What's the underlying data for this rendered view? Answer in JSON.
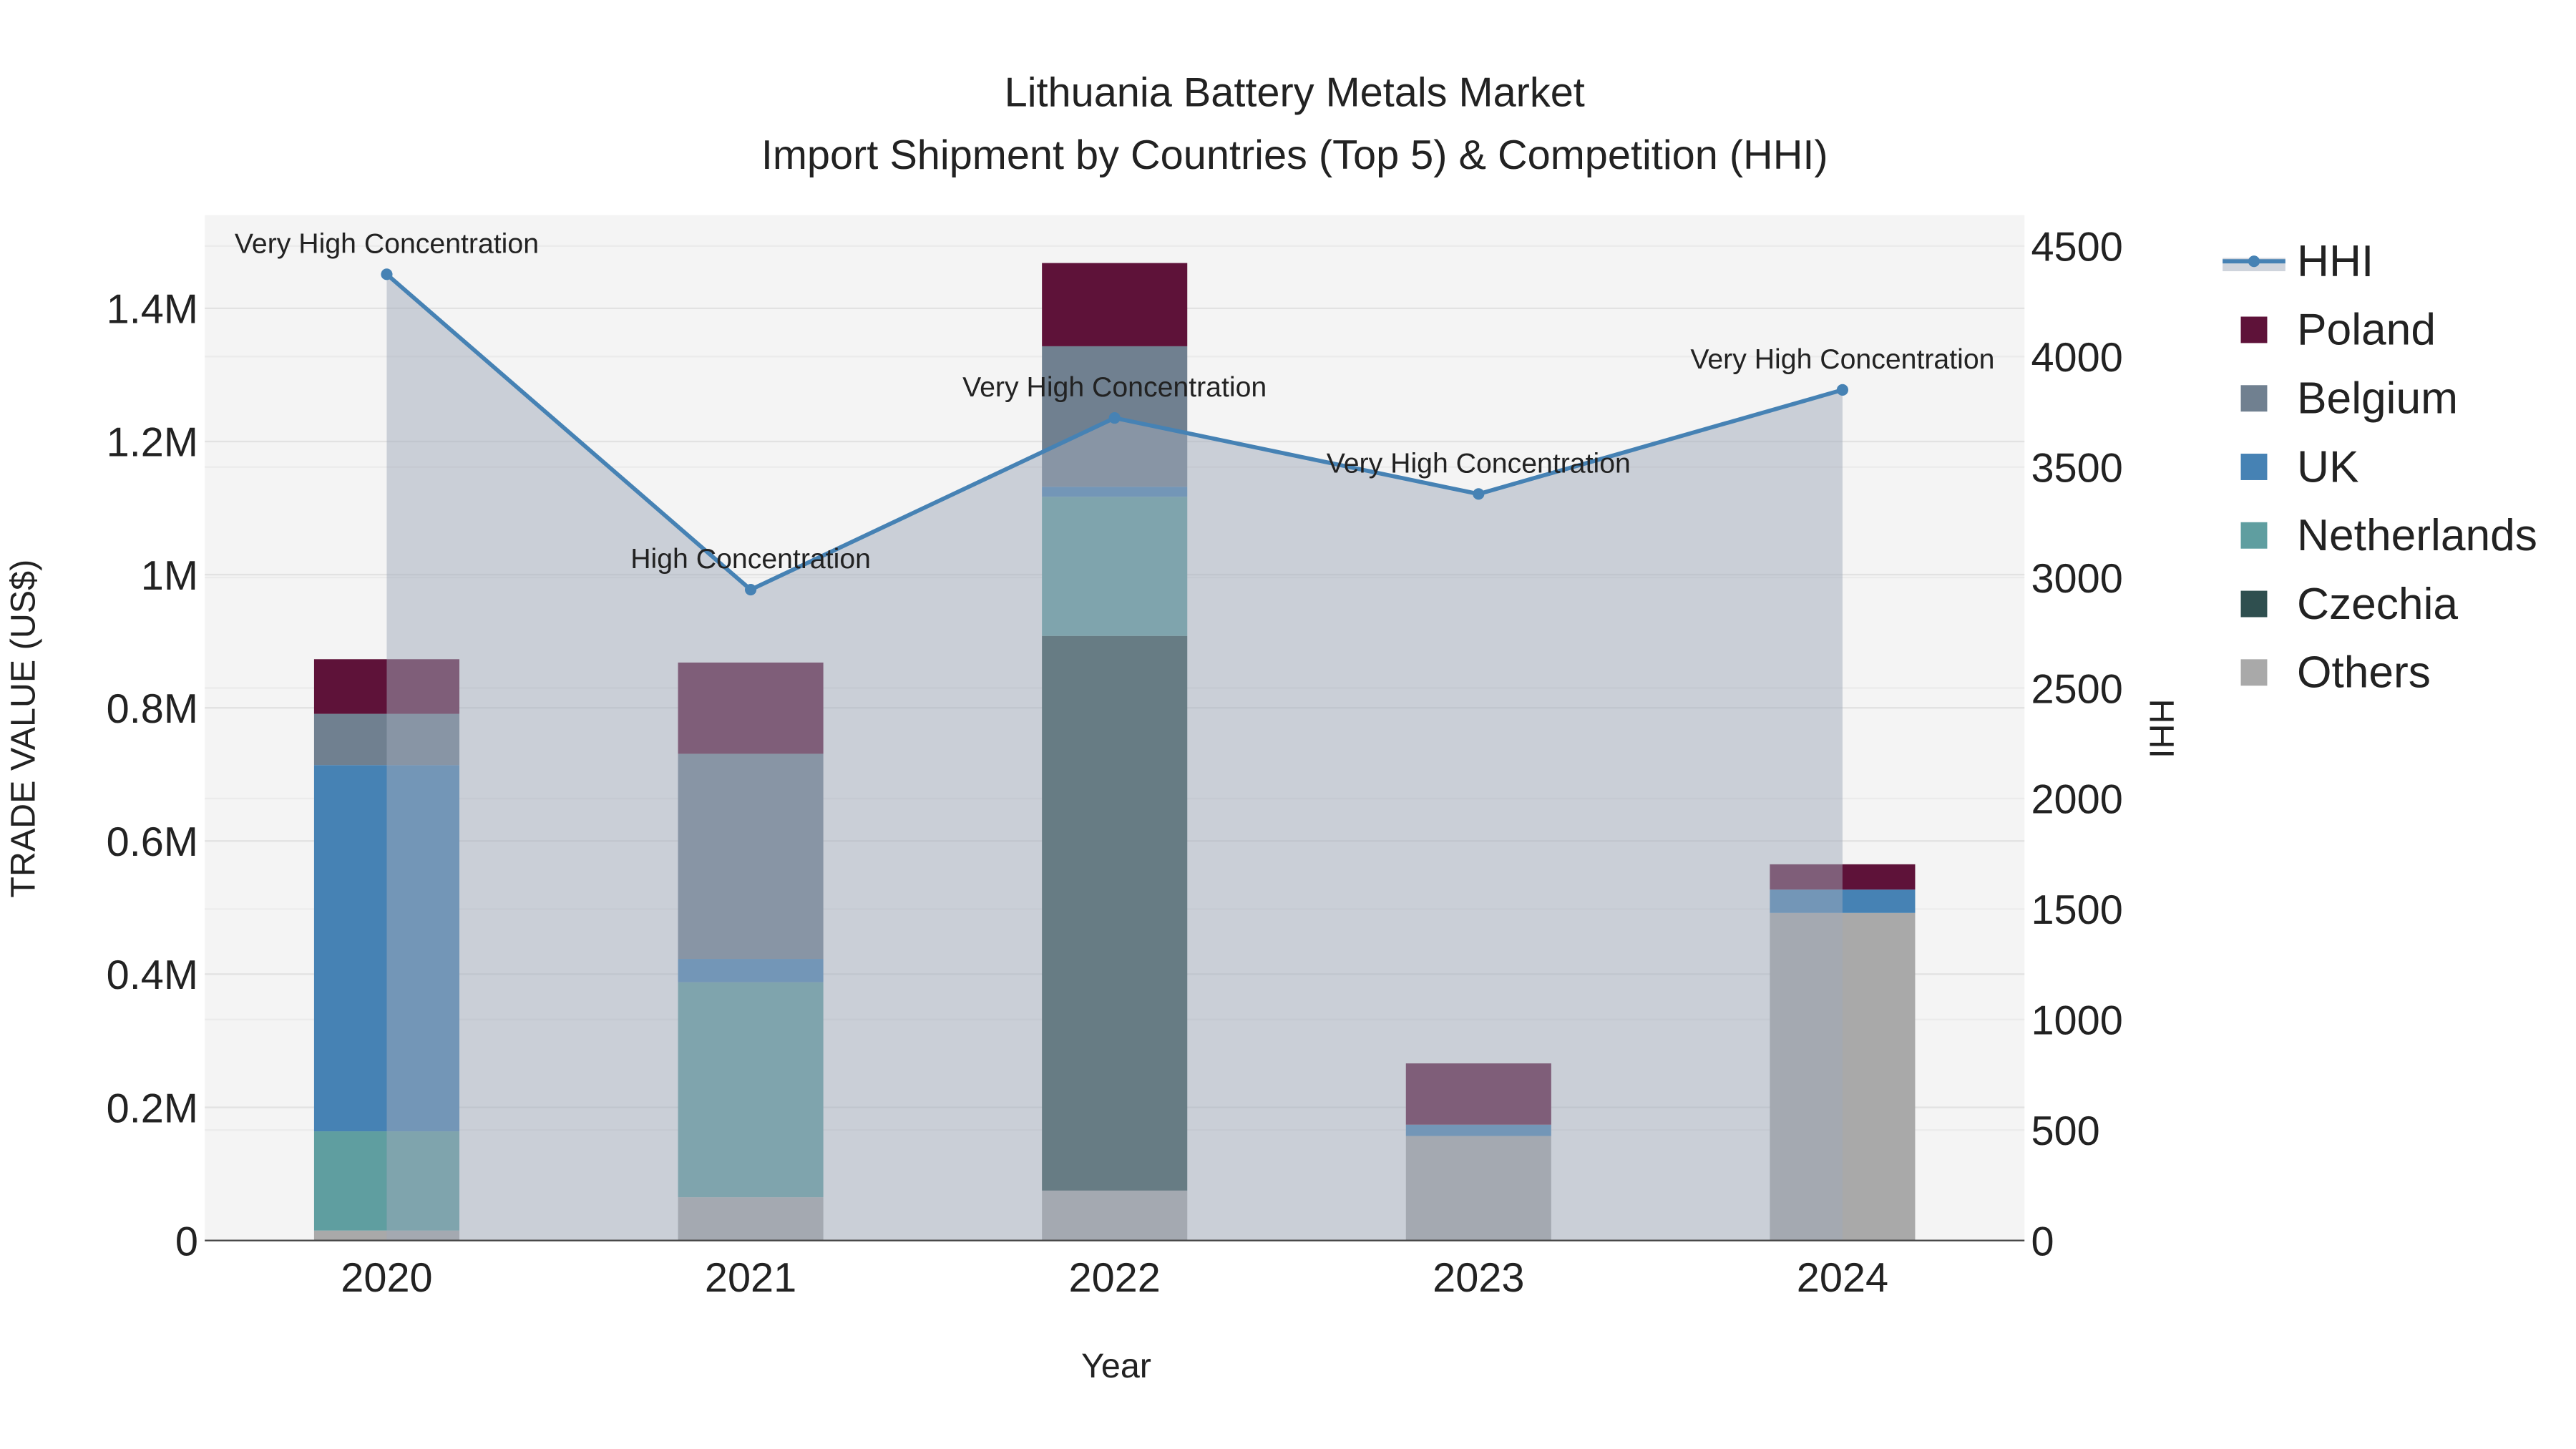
{
  "chart_data": {
    "type": "bar",
    "title": "Lithuania Battery Metals Market",
    "subtitle": "Import Shipment by Countries (Top 5) & Competition (HHI)",
    "xlabel": "Year",
    "ylabel": "TRADE VALUE (US$)",
    "y2label": "HHI",
    "categories": [
      "2020",
      "2021",
      "2022",
      "2023",
      "2024"
    ],
    "ylim": [
      0,
      1540000
    ],
    "y2lim": [
      0,
      4640
    ],
    "yticks": [
      0,
      200000,
      400000,
      600000,
      800000,
      1000000,
      1200000,
      1400000
    ],
    "ytick_labels": [
      "0",
      "0.2M",
      "0.4M",
      "0.6M",
      "0.8M",
      "1M",
      "1.2M",
      "1.4M"
    ],
    "y2ticks": [
      0,
      500,
      1000,
      1500,
      2000,
      2500,
      3000,
      3500,
      4000,
      4500
    ],
    "y2tick_labels": [
      "0",
      "500",
      "1000",
      "1500",
      "2000",
      "2500",
      "3000",
      "3500",
      "4000",
      "4500"
    ],
    "stack_order": "bottom-to-top",
    "series": [
      {
        "name": "Others",
        "color": "#a9a9a9",
        "values": [
          15000,
          65000,
          75000,
          157000,
          492000
        ]
      },
      {
        "name": "Czechia",
        "color": "#2f4f4f",
        "values": [
          0,
          0,
          833000,
          0,
          0
        ]
      },
      {
        "name": "Netherlands",
        "color": "#5f9ea0",
        "values": [
          149000,
          323000,
          209000,
          0,
          0
        ]
      },
      {
        "name": "UK",
        "color": "#4682b4",
        "values": [
          550000,
          35000,
          15000,
          17000,
          35000
        ]
      },
      {
        "name": "Belgium",
        "color": "#708090",
        "values": [
          77000,
          308000,
          211000,
          0,
          0
        ]
      },
      {
        "name": "Poland",
        "color": "#5e1239",
        "values": [
          82000,
          137000,
          125000,
          92000,
          38000
        ]
      }
    ],
    "hhi": {
      "name": "HHI",
      "color": "#4682b4",
      "values": [
        4372,
        2945,
        3722,
        3378,
        3849
      ],
      "annotations": [
        "Very High Concentration",
        "High Concentration",
        "Very High Concentration",
        "Very High Concentration",
        "Very High Concentration"
      ]
    },
    "legend": [
      "HHI",
      "Poland",
      "Belgium",
      "UK",
      "Netherlands",
      "Czechia",
      "Others"
    ],
    "legend_placement": "right",
    "grid": true
  }
}
